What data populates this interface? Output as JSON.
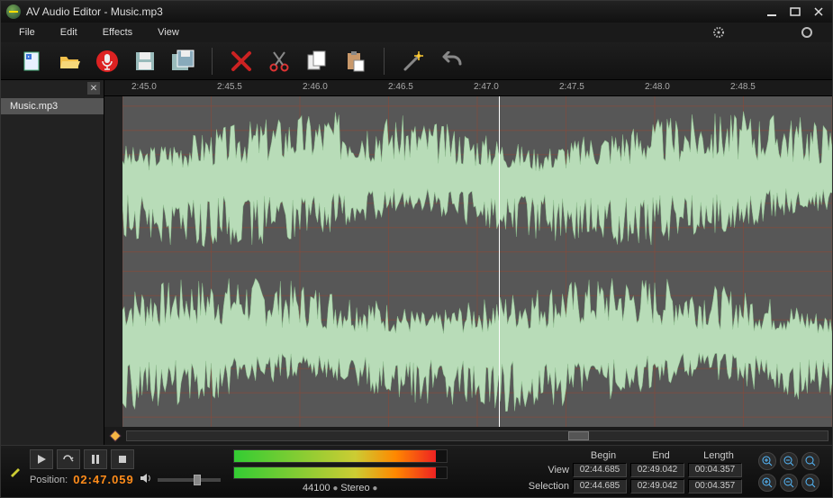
{
  "app": {
    "title": "AV Audio Editor - Music.mp3"
  },
  "menu": {
    "file": "File",
    "edit": "Edit",
    "effects": "Effects",
    "view": "View"
  },
  "sidebar": {
    "items": [
      "Music.mp3"
    ]
  },
  "ruler": {
    "ticks": [
      "2:45.0",
      "2:45.5",
      "2:46.0",
      "2:46.5",
      "2:47.0",
      "2:47.5",
      "2:48.0",
      "2:48.5"
    ]
  },
  "amp_scale": [
    75,
    50,
    25,
    0,
    -25,
    -50,
    -75
  ],
  "playhead_percent": 53,
  "scroll": {
    "thumb_left_pct": 63,
    "thumb_width_pct": 3
  },
  "transport": {
    "position_label": "Position:",
    "position_value": "02:47.059",
    "sample_rate": "44100",
    "channels": "Stereo"
  },
  "meters": {
    "left_pct": 95,
    "right_pct": 95
  },
  "ranges": {
    "headers": {
      "begin": "Begin",
      "end": "End",
      "length": "Length"
    },
    "view": {
      "label": "View",
      "begin": "02:44.685",
      "end": "02:49.042",
      "length": "00:04.357"
    },
    "selection": {
      "label": "Selection",
      "begin": "02:44.685",
      "end": "02:49.042",
      "length": "00:04.357"
    }
  },
  "colors": {
    "accent": "#ff8c1a",
    "wave": "#b8dcb8"
  }
}
